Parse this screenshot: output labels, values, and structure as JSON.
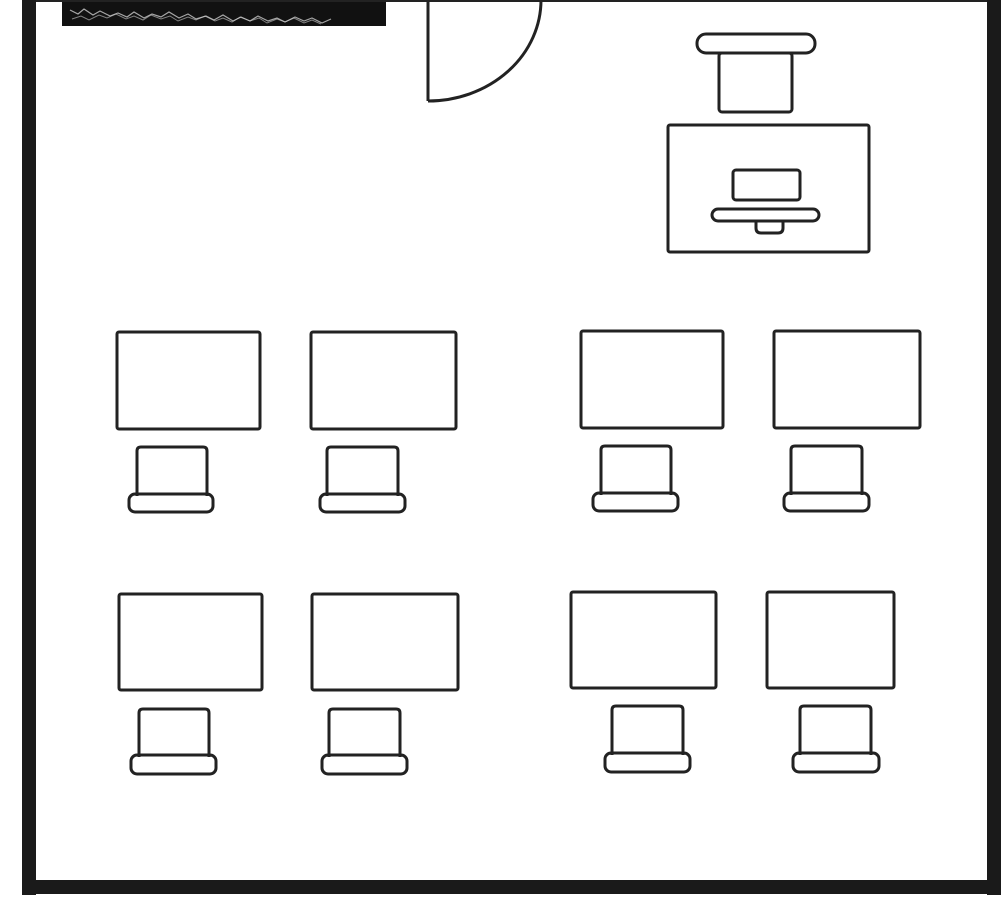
{
  "colors": {
    "background": "#ffffff",
    "wall": "#1a1a1a",
    "stroke": "#222222",
    "whiteboard": "#111111"
  },
  "icons": {
    "wall": "thick-wall-line",
    "door": "door-swing-arc",
    "whiteboard": "dark-board-strip",
    "teacher_desk": "rectangle",
    "teacher_chair": "chair-outline",
    "teacher_computer": "monitor-outline",
    "student_desk": "rectangle",
    "student_chair": "chair-outline"
  },
  "room": {
    "student_desk_groups": 2,
    "student_desks_per_group": 4,
    "student_desk_count": 8,
    "student_chair_count": 8,
    "door_count": 1,
    "teacher_station_count": 1
  }
}
